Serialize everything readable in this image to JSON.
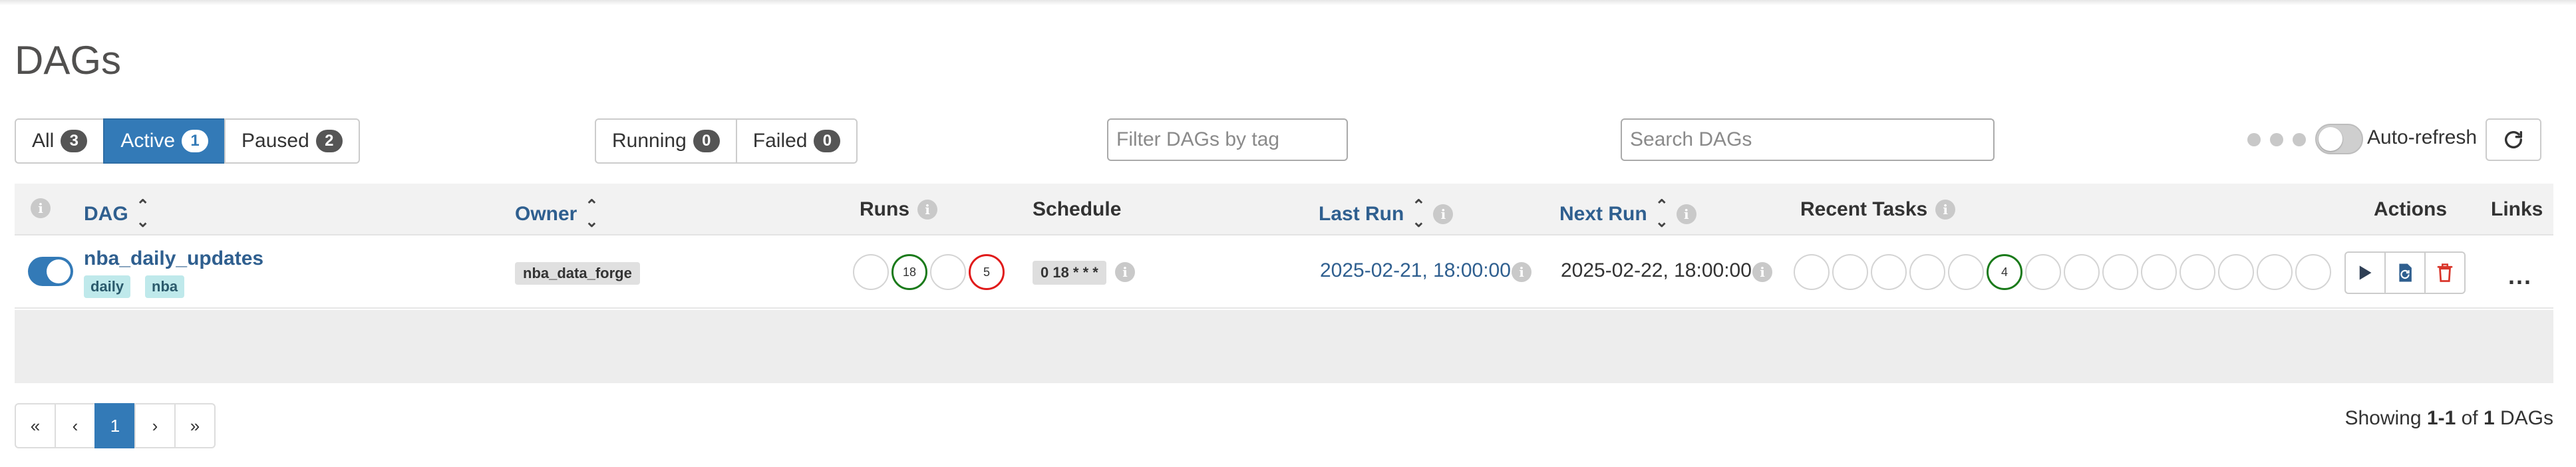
{
  "page": {
    "title": "DAGs"
  },
  "filters": {
    "status": [
      {
        "label": "All",
        "count": "3"
      },
      {
        "label": "Active",
        "count": "1"
      },
      {
        "label": "Paused",
        "count": "2"
      }
    ],
    "runs": [
      {
        "label": "Running",
        "count": "0"
      },
      {
        "label": "Failed",
        "count": "0"
      }
    ],
    "tag_placeholder": "Filter DAGs by tag",
    "search_placeholder": "Search DAGs",
    "autorefresh_label": "Auto-refresh"
  },
  "table": {
    "headers": {
      "dag": "DAG",
      "owner": "Owner",
      "runs": "Runs",
      "schedule": "Schedule",
      "last_run": "Last Run",
      "next_run": "Next Run",
      "recent_tasks": "Recent Tasks",
      "actions": "Actions",
      "links": "Links"
    },
    "rows": [
      {
        "dag_id": "nba_daily_updates",
        "tags": [
          "daily",
          "nba"
        ],
        "owner": "nba_data_forge",
        "runs": [
          "",
          "18",
          "",
          "5"
        ],
        "schedule": "0 18 * * *",
        "last_run": "2025-02-21, 18:00:00",
        "next_run": "2025-02-22, 18:00:00",
        "recent_tasks": [
          "",
          "",
          "",
          "",
          "",
          "4",
          "",
          "",
          "",
          "",
          "",
          "",
          "",
          ""
        ],
        "links_label": "..."
      }
    ]
  },
  "pagination": {
    "first": "«",
    "prev": "‹",
    "current": "1",
    "next": "›",
    "last": "»"
  },
  "footer": {
    "showing_prefix": "Showing ",
    "showing_range": "1-1",
    "showing_of": " of ",
    "showing_total": "1",
    "showing_suffix": " DAGs"
  },
  "colors": {
    "accent": "#337ab7",
    "link": "#2f5f8f",
    "success": "#1a7a1a",
    "failed": "#e01a1a",
    "tag_bg": "#bfe9eb"
  },
  "icons": {
    "refresh": "refresh-icon",
    "trigger": "play-icon",
    "clear": "refresh-dag-icon",
    "delete": "trash-icon",
    "info": "info-icon",
    "sort": "sort-icon"
  }
}
